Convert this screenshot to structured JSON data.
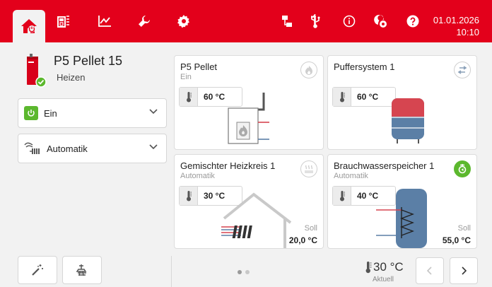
{
  "header": {
    "icons": [
      "home-icon",
      "boiler-icon",
      "chart-icon",
      "wrench-icon",
      "gear-icon",
      "network-icon",
      "usb-icon",
      "info-icon",
      "user-settings-icon",
      "help-icon"
    ],
    "date": "01.01.2026",
    "time": "10:10"
  },
  "device": {
    "name": "P5 Pellet 15",
    "status": "Heizen"
  },
  "controls": {
    "power_label": "Ein",
    "mode_label": "Automatik"
  },
  "cards": {
    "pellet": {
      "title": "P5 Pellet",
      "subtitle": "Ein",
      "temp": "60 °C"
    },
    "buffer": {
      "title": "Puffersystem 1",
      "temp": "60 °C"
    },
    "heating": {
      "title": "Gemischter Heizkreis 1",
      "subtitle": "Automatik",
      "temp": "30 °C",
      "soll_label": "Soll",
      "soll_value": "20,0 °C"
    },
    "dhw": {
      "title": "Brauchwasserspeicher 1",
      "subtitle": "Automatik",
      "temp": "40 °C",
      "soll_label": "Soll",
      "soll_value": "55,0 °C"
    }
  },
  "footer": {
    "current_temp": "30 °C",
    "current_label": "Aktuell",
    "page_count": 2,
    "active_page": 1
  },
  "colors": {
    "brand_red": "#e3001b",
    "status_green": "#5cb82e",
    "tank_red": "#d64550",
    "tank_blue": "#5b7fa6"
  }
}
